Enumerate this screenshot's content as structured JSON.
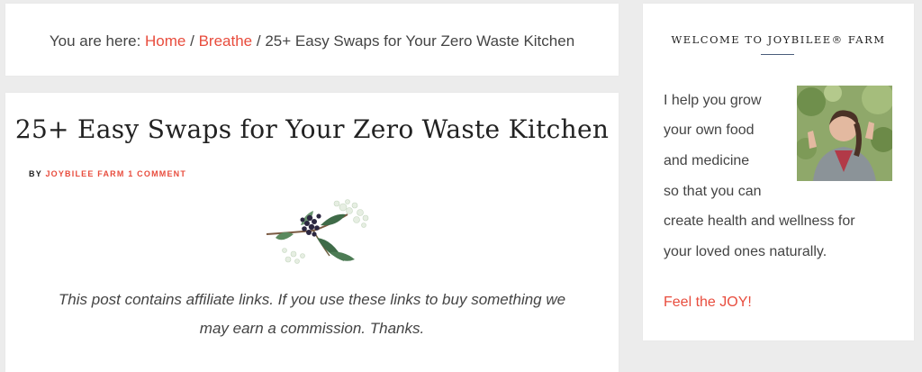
{
  "breadcrumb": {
    "prefix": "You are here:",
    "home": "Home",
    "sep1": "/",
    "category": "Breathe",
    "sep2": "/",
    "current": "25+ Easy Swaps for Your Zero Waste Kitchen"
  },
  "post": {
    "title": "25+ Easy Swaps for Your Zero Waste Kitchen",
    "meta_by": "BY",
    "author": "JOYBILEE FARM",
    "comments": "1 COMMENT",
    "affiliate_line1": "This post contains affiliate links. If you use these links to buy something we",
    "affiliate_line2": "may earn a commission. Thanks."
  },
  "sidebar": {
    "heading": "WELCOME TO JOYBILEE® FARM",
    "intro_lines": [
      "I help you grow",
      "your own food",
      "and medicine",
      "so that you can",
      "create health and wellness for",
      "your loved ones naturally."
    ],
    "cta": "Feel the JOY!"
  },
  "colors": {
    "accent": "#e84c3d",
    "page_bg": "#ececec",
    "card_bg": "#ffffff"
  },
  "icons": {
    "divider": "elderberry-sprig-icon",
    "avatar": "author-photo"
  }
}
